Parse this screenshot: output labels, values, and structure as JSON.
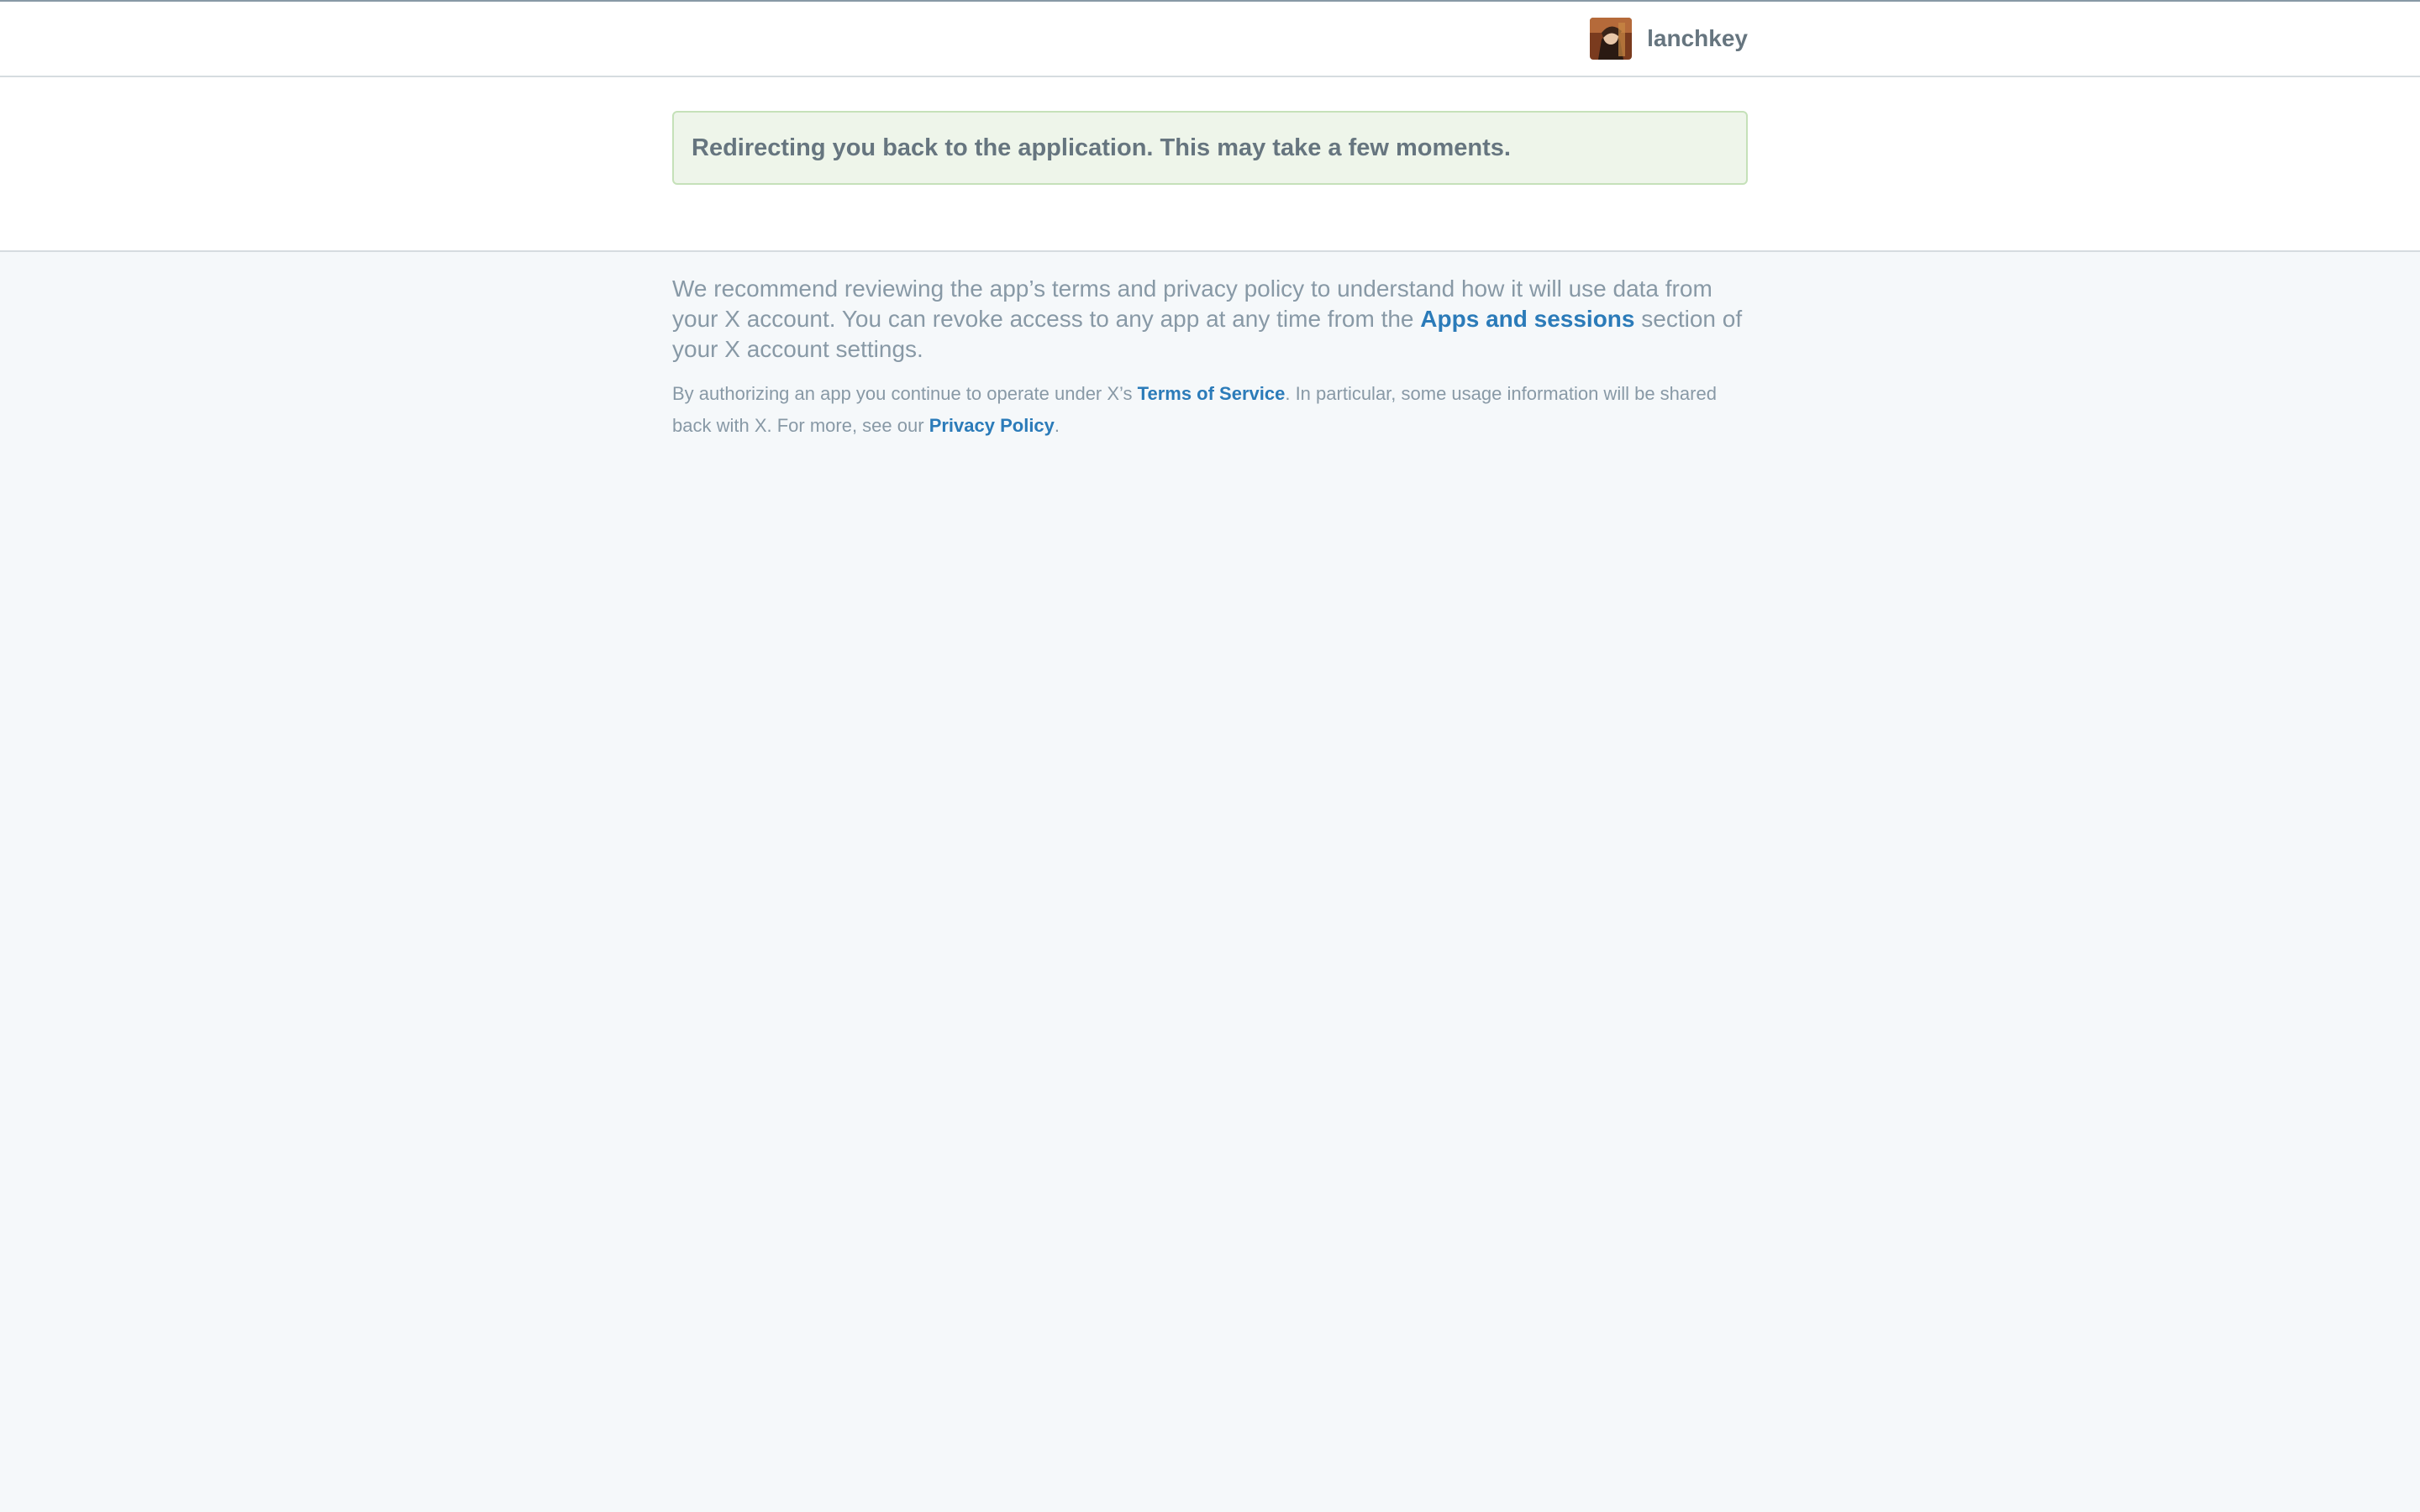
{
  "header": {
    "username": "lanchkey",
    "avatar_icon": "user-avatar-icon"
  },
  "notice": {
    "message": "Redirecting you back to the application. This may take a few moments."
  },
  "footer": {
    "recommend_text": "We recommend reviewing the app’s terms and privacy policy to understand how it will use data from your X account. You can revoke access to any app at any time from the",
    "apps_sessions_link": "Apps and sessions",
    "recommend_suffix": "section of your X account settings.",
    "legal_prefix": "By authorizing an app you continue to operate under X’s",
    "terms_link": "Terms of Service",
    "legal_middle": ". In particular, some usage information will be shared back with X. For more, see our",
    "privacy_link": "Privacy Policy",
    "legal_end": "."
  },
  "colors": {
    "link": "#2b7bb9",
    "notice_bg": "#eef5ea",
    "notice_border": "#c5e1b9",
    "page_bg": "#f5f8fa"
  }
}
